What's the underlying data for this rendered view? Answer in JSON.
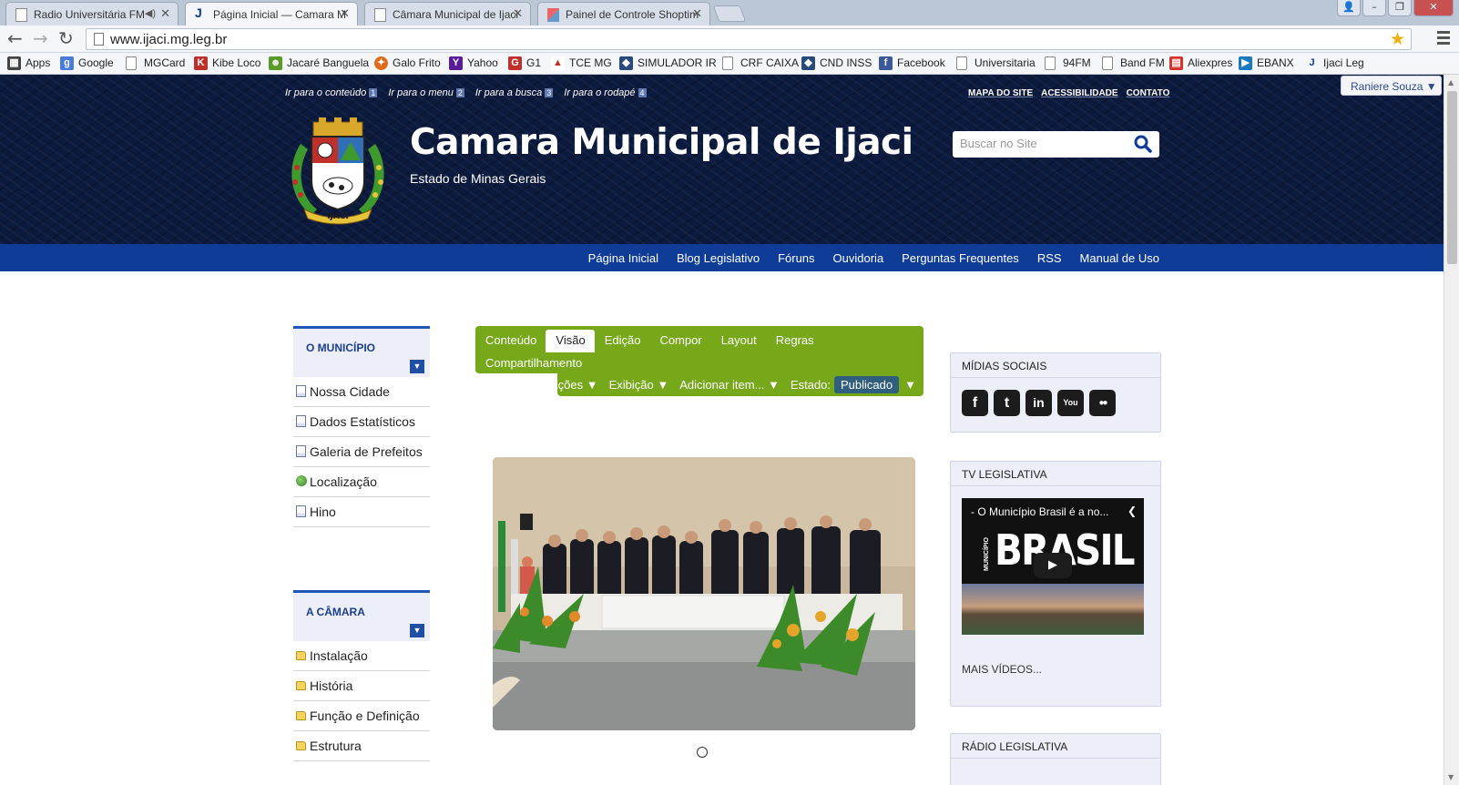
{
  "browser": {
    "tabs": [
      {
        "title": "Radio Universitária FM",
        "active": false
      },
      {
        "title": "Página Inicial — Camara M",
        "active": true
      },
      {
        "title": "Câmara Municipal de Ijaci",
        "active": false
      },
      {
        "title": "Painel de Controle Shoptim",
        "active": false
      }
    ],
    "url": "www.ijaci.mg.leg.br",
    "bookmarks": [
      {
        "label": "Apps",
        "icon": "apps-icon"
      },
      {
        "label": "Google",
        "icon": "google-icon"
      },
      {
        "label": "MGCard",
        "icon": "page-icon"
      },
      {
        "label": "Kibe Loco",
        "icon": "kibe-icon"
      },
      {
        "label": "Jacaré Banguela",
        "icon": "jacare-icon"
      },
      {
        "label": "Galo Frito",
        "icon": "galo-icon"
      },
      {
        "label": "Yahoo",
        "icon": "yahoo-icon"
      },
      {
        "label": "G1",
        "icon": "g1-icon"
      },
      {
        "label": "TCE MG",
        "icon": "tce-icon"
      },
      {
        "label": "SIMULADOR IR",
        "icon": "receita-icon"
      },
      {
        "label": "CRF CAIXA",
        "icon": "page-icon"
      },
      {
        "label": "CND INSS",
        "icon": "receita-icon"
      },
      {
        "label": "Facebook",
        "icon": "facebook-icon"
      },
      {
        "label": "Universitaria",
        "icon": "page-icon"
      },
      {
        "label": "94FM",
        "icon": "page-icon"
      },
      {
        "label": "Band FM",
        "icon": "page-icon"
      },
      {
        "label": "Aliexpres",
        "icon": "aliexpress-icon"
      },
      {
        "label": "EBANX",
        "icon": "ebanx-icon"
      },
      {
        "label": "Ijaci Leg",
        "icon": "ijaci-icon"
      }
    ]
  },
  "header": {
    "skip_links": [
      {
        "label": "Ir para o conteúdo",
        "key": "1"
      },
      {
        "label": "Ir para o menu",
        "key": "2"
      },
      {
        "label": "Ir para a busca",
        "key": "3"
      },
      {
        "label": "Ir para o rodapé",
        "key": "4"
      }
    ],
    "util_links": [
      "MAPA DO SITE",
      "ACESSIBILIDADE",
      "CONTATO"
    ],
    "title": "Camara Municipal de Ijaci",
    "subtitle": "Estado de Minas Gerais",
    "crest_text": "IJACI",
    "search_placeholder": "Buscar no Site",
    "user_menu": "Raniere Souza ▼"
  },
  "topnav": [
    "Página Inicial",
    "Blog Legislativo",
    "Fóruns",
    "Ouvidoria",
    "Perguntas Frequentes",
    "RSS",
    "Manual de Uso"
  ],
  "sidebar": {
    "municipio": {
      "title": "O MUNICÍPIO",
      "items": [
        {
          "label": "Nossa Cidade",
          "icon": "doc"
        },
        {
          "label": "Dados Estatísticos",
          "icon": "doc"
        },
        {
          "label": "Galeria de Prefeitos",
          "icon": "doc"
        },
        {
          "label": "Localização",
          "icon": "globe"
        },
        {
          "label": "Hino",
          "icon": "doc"
        }
      ]
    },
    "camara": {
      "title": "A CÂMARA",
      "items": [
        {
          "label": "Instalação",
          "icon": "folder"
        },
        {
          "label": "História",
          "icon": "folder"
        },
        {
          "label": "Função e Definição",
          "icon": "folder"
        },
        {
          "label": "Estrutura",
          "icon": "folder"
        }
      ]
    }
  },
  "editbar": {
    "tabs": [
      "Conteúdo",
      "Visão",
      "Edição",
      "Compor",
      "Layout",
      "Regras",
      "Compartilhamento"
    ],
    "active_tab": "Visão",
    "actions": [
      "Ações ▼",
      "Exibição ▼",
      "Adicionar item... ▼"
    ],
    "state_label": "Estado:",
    "state_value": "Publicado",
    "state_arrow": "▼"
  },
  "right": {
    "social_title": "MÍDIAS SOCIAIS",
    "social_icons": [
      {
        "name": "facebook-icon",
        "glyph": "f"
      },
      {
        "name": "twitter-icon",
        "glyph": "t"
      },
      {
        "name": "linkedin-icon",
        "glyph": "in"
      },
      {
        "name": "youtube-icon",
        "glyph": "You"
      },
      {
        "name": "flickr-icon",
        "glyph": "●●"
      }
    ],
    "tv_title": "TV LEGISLATIVA",
    "video_title": "- O Município Brasil é a no...",
    "video_brand": "BRASIL",
    "video_brand_small": "MUNICÍPIO",
    "more_videos": "MAIS VÍDEOS...",
    "radio_title": "RÁDIO LEGISLATIVA"
  }
}
